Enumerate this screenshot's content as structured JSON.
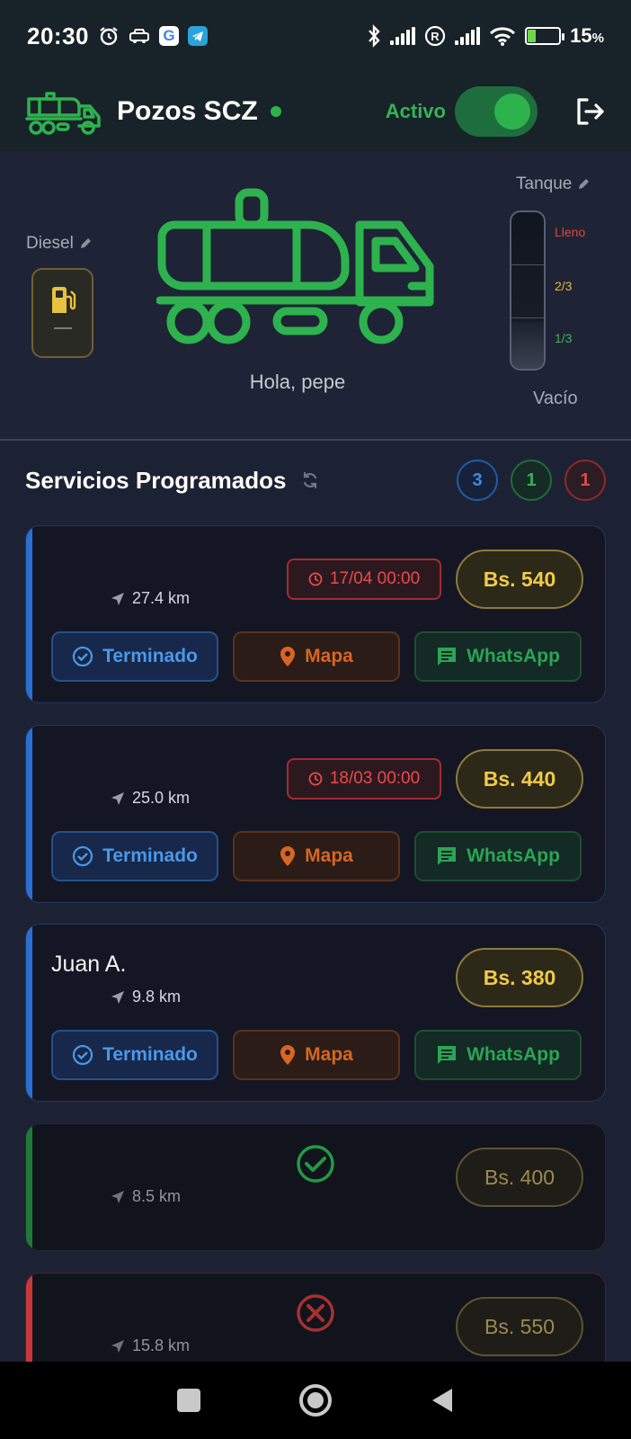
{
  "status_bar": {
    "time": "20:30",
    "battery": "15",
    "battery_unit": "%",
    "icons": [
      "alarm-icon",
      "car-icon",
      "google-icon",
      "telegram-icon",
      "bluetooth-icon",
      "signal-icon",
      "roaming-icon",
      "signal-icon",
      "wifi-icon",
      "battery-icon"
    ]
  },
  "app_bar": {
    "title": "Pozos SCZ",
    "active_label": "Activo",
    "toggle_on": true,
    "colors": {
      "accent": "#2eb24e",
      "background": "#182229"
    }
  },
  "hero": {
    "diesel_label": "Diesel",
    "diesel_value": "—",
    "greeting": "Hola, pepe",
    "tank_label": "Tanque",
    "tank_levels": {
      "full": "Lleno",
      "two_thirds": "2/3",
      "one_third": "1/3",
      "empty": "Vacío"
    }
  },
  "services": {
    "title": "Servicios Programados",
    "counters": {
      "blue": "3",
      "green": "1",
      "red": "1"
    },
    "items": [
      {
        "client": "",
        "distance": "27.4 km",
        "date": "17/04 00:00",
        "price": "Bs. 540",
        "status": "pending",
        "done_label": "Terminado",
        "map_label": "Mapa",
        "whatsapp_label": "WhatsApp"
      },
      {
        "client": "",
        "distance": "25.0 km",
        "date": "18/03 00:00",
        "price": "Bs. 440",
        "status": "pending",
        "done_label": "Terminado",
        "map_label": "Mapa",
        "whatsapp_label": "WhatsApp"
      },
      {
        "client": "Juan A.",
        "distance": "9.8 km",
        "date": "",
        "price": "Bs. 380",
        "status": "pending",
        "done_label": "Terminado",
        "map_label": "Mapa",
        "whatsapp_label": "WhatsApp"
      },
      {
        "client": "",
        "distance": "8.5 km",
        "price": "Bs. 400",
        "status": "completed"
      },
      {
        "client": "",
        "distance": "15.8 km",
        "price": "Bs. 550",
        "status": "cancelled"
      }
    ]
  },
  "nav_bar": {
    "icons": [
      "recents-icon",
      "home-icon",
      "back-icon"
    ]
  }
}
